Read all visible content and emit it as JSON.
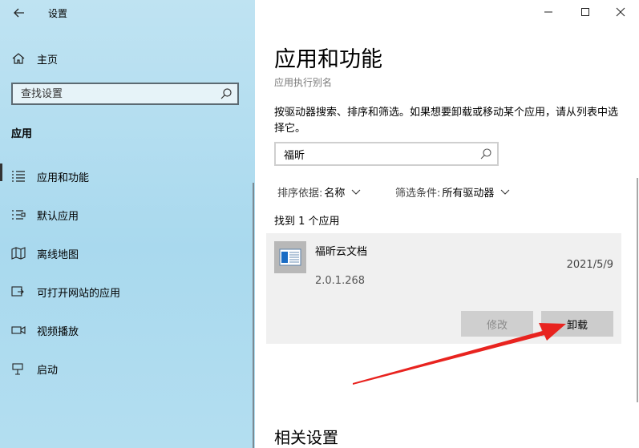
{
  "window": {
    "title": "设置"
  },
  "sidebar": {
    "home_label": "主页",
    "search_placeholder": "查找设置",
    "section_title": "应用",
    "items": [
      {
        "label": "应用和功能",
        "icon": "apps-features-icon"
      },
      {
        "label": "默认应用",
        "icon": "default-apps-icon"
      },
      {
        "label": "离线地图",
        "icon": "offline-maps-icon"
      },
      {
        "label": "可打开网站的应用",
        "icon": "apps-for-websites-icon"
      },
      {
        "label": "视频播放",
        "icon": "video-playback-icon"
      },
      {
        "label": "启动",
        "icon": "startup-icon"
      }
    ]
  },
  "main": {
    "title": "应用和功能",
    "alias_link": "应用执行别名",
    "description": "按驱动器搜索、排序和筛选。如果想要卸载或移动某个应用，请从列表中选择它。",
    "search_value": "福昕",
    "sort_label": "排序依据:",
    "sort_value": "名称",
    "filter_label": "筛选条件:",
    "filter_value": "所有驱动器",
    "found_text": "找到 1 个应用",
    "app": {
      "name": "福昕云文档",
      "date": "2021/5/9",
      "version": "2.0.1.268",
      "modify_label": "修改",
      "uninstall_label": "卸载"
    },
    "related_title": "相关设置"
  },
  "colors": {
    "sidebar_bg": "#a9d9ee",
    "annotation_arrow": "#e8231f"
  }
}
